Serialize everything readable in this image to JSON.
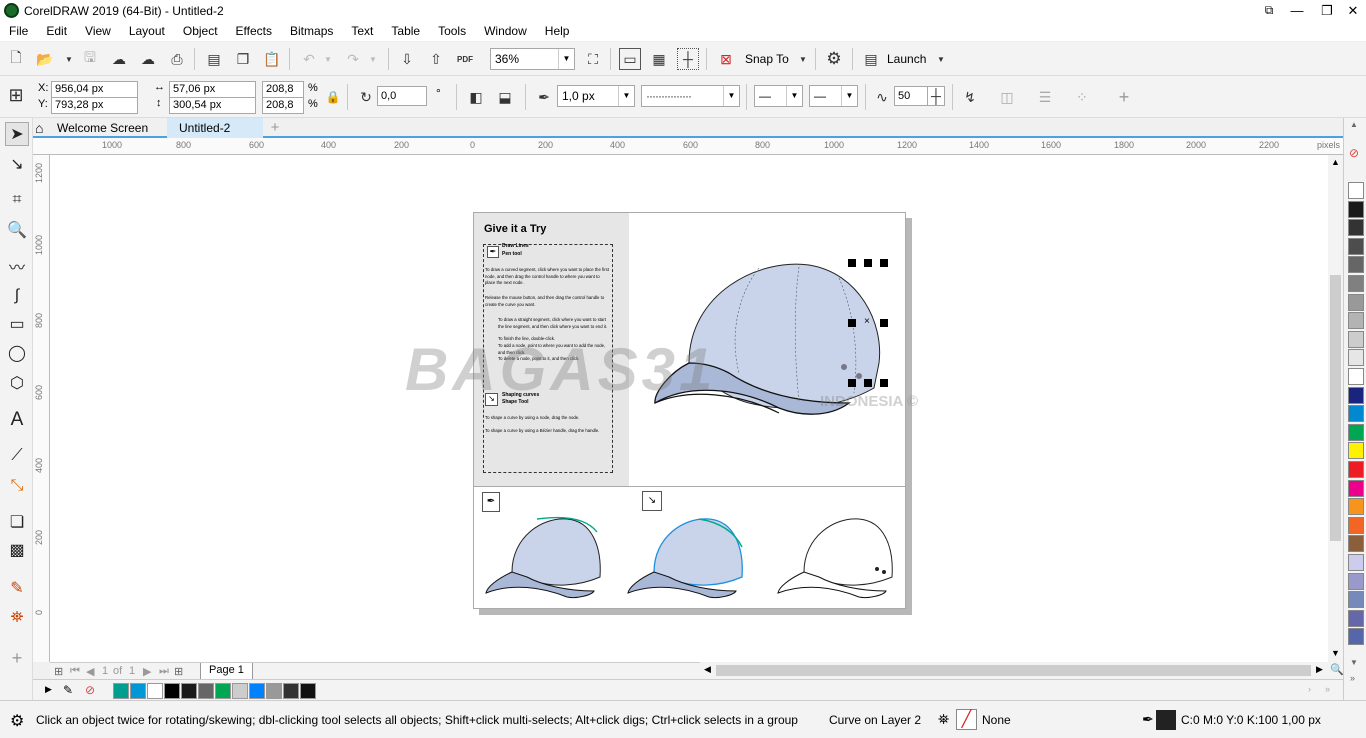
{
  "window": {
    "title": "CorelDRAW 2019 (64-Bit) - Untitled-2",
    "buttons": [
      "minimize",
      "restore",
      "close"
    ]
  },
  "menu": [
    "File",
    "Edit",
    "View",
    "Layout",
    "Object",
    "Effects",
    "Bitmaps",
    "Text",
    "Table",
    "Tools",
    "Window",
    "Help"
  ],
  "standard_toolbar": {
    "zoom_value": "36%",
    "snap_to_label": "Snap To",
    "launch_label": "Launch",
    "pdf_label": "PDF"
  },
  "property_bar": {
    "x_label": "X:",
    "x_value": "956,04 px",
    "y_label": "Y:",
    "y_value": "793,28 px",
    "w_value": "57,06 px",
    "h_value": "300,54 px",
    "scale_w": "208,8",
    "scale_h": "208,8",
    "pct": "%",
    "rotation": "0,0",
    "degree": "°",
    "outline_width": "1,0 px",
    "smoothing": "50"
  },
  "tabs": [
    {
      "label": "Welcome Screen",
      "active": false
    },
    {
      "label": "Untitled-2",
      "active": true
    }
  ],
  "ruler": {
    "h_ticks": [
      "1000",
      "800",
      "600",
      "400",
      "200",
      "0",
      "200",
      "400",
      "600",
      "800",
      "1000",
      "1200",
      "1400",
      "1600",
      "1800",
      "2000",
      "2200"
    ],
    "h_unit": "pixels",
    "v_ticks": [
      "1200",
      "1000",
      "800",
      "600",
      "400",
      "200",
      "0"
    ]
  },
  "document": {
    "tutorial_title": "Give it a Try",
    "draw_lines_title": "Draw Lines",
    "pen_tool_label": "Pen tool",
    "text1": "To draw a curved segment, click where you want to place the first node, and then drag the control handle to where you want to place the next node.",
    "text2": "Release the mouse button, and then drag the control handle to create the curve you want.",
    "bullets": [
      "To draw a straight segment, click where you want to start the line segment, and then click where you want to end it.",
      "To finish the line, double-click.",
      "To add a node, point to where you want to add the node, and then click.",
      "To delete a node, point to it, and then click."
    ],
    "shaping_title": "Shaping curves",
    "shape_tool_label": "Shape Tool",
    "text3": "To shape a curve by using a node, drag the node.",
    "text4": "To shape a curve by using a Bézier handle, drag the handle.",
    "watermark": "BAGAS31",
    "watermark_sub": "INDONESIA ©"
  },
  "page_nav": {
    "current": "1",
    "of": "of",
    "total": "1",
    "page_tab": "Page 1"
  },
  "doc_palette_colors": [
    "#009e8e",
    "#0097d6",
    "#ffffff",
    "#000000",
    "#1a1a1a",
    "#666666",
    "#00a651",
    "#cccccc",
    "#0082ff",
    "#999999",
    "#333333",
    "#111111"
  ],
  "palette_colors": [
    "#ffffff",
    "#1a1a1a",
    "#333333",
    "#4d4d4d",
    "#666666",
    "#808080",
    "#999999",
    "#b3b3b3",
    "#cccccc",
    "#e6e6e6",
    "#ffffff",
    "#1a237e",
    "#0288d1",
    "#00a651",
    "#fff200",
    "#ed1c24",
    "#ec008c",
    "#f7941d",
    "#f26522",
    "#8b5e3c",
    "#ccccee",
    "#9999cc",
    "#7788bb",
    "#6666aa",
    "#5566aa"
  ],
  "status": {
    "hint": "Click an object twice for rotating/skewing; dbl-clicking tool selects all objects; Shift+click multi-selects; Alt+click digs; Ctrl+click selects in a group",
    "selection": "Curve on Layer 2",
    "fill": "None",
    "outline": "C:0 M:0 Y:0 K:100  1,00 px"
  }
}
